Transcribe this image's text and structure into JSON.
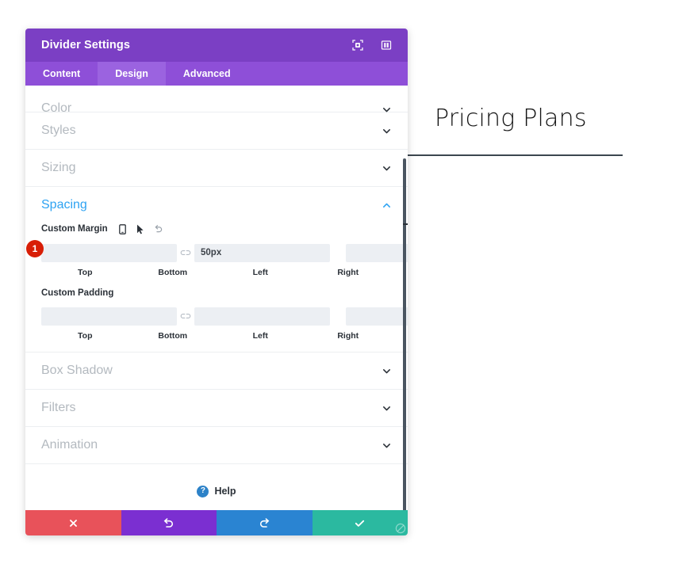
{
  "panel": {
    "title": "Divider Settings",
    "header_icons": [
      {
        "name": "focus-target-icon",
        "label": "Focus"
      },
      {
        "name": "layout-columns-icon",
        "label": "Layout"
      }
    ],
    "tabs": [
      {
        "label": "Content",
        "active": false
      },
      {
        "label": "Design",
        "active": true
      },
      {
        "label": "Advanced",
        "active": false
      }
    ],
    "sections": [
      {
        "label": "Color",
        "open": false,
        "chevron": "chevron-down"
      },
      {
        "label": "Styles",
        "open": false,
        "chevron": "chevron-down"
      },
      {
        "label": "Sizing",
        "open": false,
        "chevron": "chevron-down"
      },
      {
        "label": "Spacing",
        "open": true,
        "chevron": "chevron-up"
      },
      {
        "label": "Box Shadow",
        "open": false,
        "chevron": "chevron-down"
      },
      {
        "label": "Filters",
        "open": false,
        "chevron": "chevron-down"
      },
      {
        "label": "Animation",
        "open": false,
        "chevron": "chevron-down"
      }
    ],
    "spacing": {
      "margin": {
        "label": "Custom Margin",
        "icons": [
          {
            "name": "mobile-device-icon"
          },
          {
            "name": "cursor-pointer-icon"
          },
          {
            "name": "reset-undo-icon"
          }
        ],
        "fields": [
          {
            "label": "Top",
            "value": "",
            "placeholder": ""
          },
          {
            "label": "Bottom",
            "value": "50px",
            "placeholder": ""
          },
          {
            "label": "Left",
            "value": "",
            "placeholder": ""
          },
          {
            "label": "Right",
            "value": "",
            "placeholder": ""
          }
        ]
      },
      "padding": {
        "label": "Custom Padding",
        "fields": [
          {
            "label": "Top",
            "value": "",
            "placeholder": ""
          },
          {
            "label": "Bottom",
            "value": "",
            "placeholder": ""
          },
          {
            "label": "Left",
            "value": "",
            "placeholder": ""
          },
          {
            "label": "Right",
            "value": "",
            "placeholder": ""
          }
        ]
      }
    },
    "help": {
      "label": "Help",
      "icon_glyph": "?"
    },
    "footer": [
      {
        "name": "cancel-button",
        "glyph": "close-x-icon",
        "color": "#e8525a"
      },
      {
        "name": "undo-button",
        "glyph": "undo-arrow-icon",
        "color": "#7b2fd1"
      },
      {
        "name": "redo-button",
        "glyph": "redo-arrow-icon",
        "color": "#2a84d2"
      },
      {
        "name": "save-button",
        "glyph": "check-icon",
        "color": "#2bb9a0"
      }
    ],
    "callout": {
      "number": "1",
      "color": "#d81e06"
    }
  },
  "page": {
    "heading": "Pricing Plans"
  },
  "colors": {
    "header_purple": "#7b3fc4",
    "tabs_purple": "#8e4fd8",
    "tab_active_purple": "#9b63e0",
    "accent_blue": "#2ea3f2",
    "muted_label": "#b3b9bf",
    "field_bg": "#eceff3"
  }
}
